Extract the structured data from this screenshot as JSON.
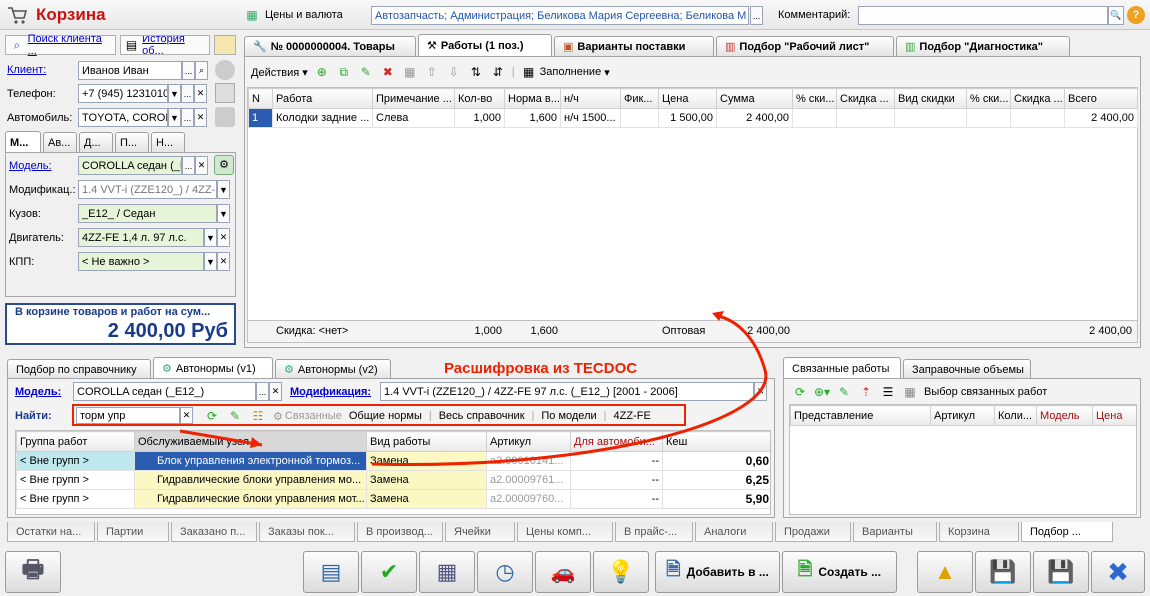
{
  "window": {
    "title": "Корзина"
  },
  "top": {
    "prices_label": "Цены и валюта",
    "org_value": "Автозапчасть; Администрация; Беликова Мария Сергеевна; Беликова М",
    "comment_label": "Комментарий:",
    "comment_value": ""
  },
  "left": {
    "search_client": "Поиск клиента ...",
    "history": "История об...",
    "client_label": "Клиент:",
    "client_value": "Иванов Иван",
    "phone_label": "Телефон:",
    "phone_value": "+7 (945) 1231010",
    "car_label": "Автомобиль:",
    "car_value": "TOYOTA, COROLI",
    "tabs": [
      "М...",
      "Ав...",
      "Д...",
      "П...",
      "Н..."
    ],
    "model_label": "Модель:",
    "model_value": "COROLLA седан (_E",
    "mod_label": "Модификац.:",
    "mod_value": "1.4 VVT-i (ZZE120_) / 4ZZ-F",
    "body_label": "Кузов:",
    "body_value": "_E12_ / Седан",
    "engine_label": "Двигатель:",
    "engine_value": "4ZZ-FE 1,4 л. 97 л.с.",
    "gear_label": "КПП:",
    "gear_value": "< Не важно >",
    "sum_caption": "В корзине товаров и работ на сум...",
    "sum_value": "2 400,00 Руб"
  },
  "main_tabs": [
    "№ 0000000004. Товары",
    "Работы (1 поз.)",
    "Варианты поставки",
    "Подбор \"Рабочий лист\"",
    "Подбор \"Диагностика\""
  ],
  "works": {
    "actions": "Действия",
    "fill": "Заполнение",
    "columns": [
      "N",
      "Работа",
      "Примечание ...",
      "Кол-во",
      "Норма в...",
      "н/ч",
      "Фик...",
      "Цена",
      "Сумма",
      "% ски...",
      "Скидка ...",
      "Вид скидки",
      "% ски...",
      "Скидка ...",
      "Всего"
    ],
    "rows": [
      [
        "1",
        "Колодки задние ...",
        "Слева",
        "1,000",
        "1,600",
        "н/ч 1500...",
        "",
        "1 500,00",
        "2 400,00",
        "",
        "",
        "",
        "",
        "",
        "2 400,00"
      ]
    ],
    "footer": {
      "discount": "Скидка: <нет>",
      "qty": "1,000",
      "norm": "1,600",
      "type": "Оптовая",
      "sum": "2 400,00",
      "total": "2 400,00"
    }
  },
  "lower_tabs": [
    "Подбор по справочнику",
    "Автонормы (v1)",
    "Автонормы (v2)"
  ],
  "annotation": "Расшифровка из TECDOC",
  "autonorm": {
    "model_label": "Модель:",
    "model_value": "COROLLA седан (_E12_)",
    "mod_label": "Модификация:",
    "mod_value": "1.4 VVT-i (ZZE120_) / 4ZZ-FE 97 л.с. (_E12_) [2001 - 2006]",
    "find_label": "Найти:",
    "find_value": "торм упр",
    "filters": [
      "Связанные",
      "Общие нормы",
      "Весь справочник",
      "По модели",
      "4ZZ-FE"
    ],
    "columns": [
      "Группа работ",
      "Обслуживаемый узел",
      "Вид работы",
      "Артикул",
      "Для автомоби...",
      "Кеш"
    ],
    "rows": [
      [
        "< Вне групп >",
        "Блок управления электронной тормоз...",
        "Замена",
        "a2.00010141...",
        "--",
        "0,60"
      ],
      [
        "< Вне групп >",
        "Гидравлические блоки управления мо...",
        "Замена",
        "a2.00009761...",
        "--",
        "6,25"
      ],
      [
        "< Вне групп >",
        "Гидравлические блоки управления мот...",
        "Замена",
        "a2.00009760...",
        "--",
        "5,90"
      ]
    ]
  },
  "related": {
    "tabs": [
      "Связанные работы",
      "Заправочные объемы"
    ],
    "select_label": "Выбор связанных работ",
    "columns": [
      "Представление",
      "Артикул",
      "Коли...",
      "Модель",
      "Цена"
    ]
  },
  "bottom_tabs": [
    "Остатки на...",
    "Партии",
    "Заказано п...",
    "Заказы пок...",
    "В производ...",
    "Ячейки",
    "Цены комп...",
    "В прайс-...",
    "Аналоги",
    "Продажи",
    "Варианты",
    "Корзина",
    "Подбор ..."
  ],
  "buttons": {
    "add": "Добавить в ...",
    "create": "Создать ..."
  },
  "colors": {
    "title_red": "#cc1111",
    "annotation_red": "#ee2200",
    "selection_blue": "#2a5db0"
  }
}
